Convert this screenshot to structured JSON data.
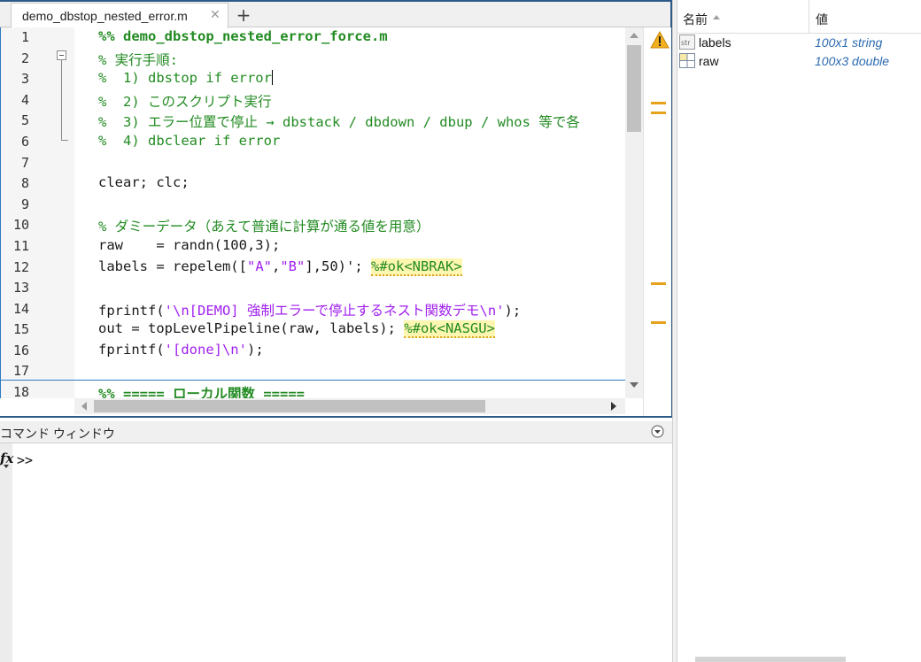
{
  "editor": {
    "tab_label": "demo_dbstop_nested_error.m",
    "tab_close_glyph": "✕",
    "tab_add_glyph": "+",
    "line_numbers": [
      "1",
      "2",
      "3",
      "4",
      "5",
      "6",
      "7",
      "8",
      "9",
      "10",
      "11",
      "12",
      "13",
      "14",
      "15",
      "16",
      "17",
      "18"
    ],
    "lines": {
      "l1": "%% demo_dbstop_nested_error_force.m",
      "l2": "% 実行手順:",
      "l3": "%  1) dbstop if error",
      "l4": "%  2) このスクリプト実行",
      "l5": "%  3) エラー位置で停止 → dbstack / dbdown / dbup / whos 等で各",
      "l6": "%  4) dbclear if error",
      "l8": "clear; clc;",
      "l10": "% ダミーデータ（あえて普通に計算が通る値を用意）",
      "l11_a": "raw    = randn(100,3);",
      "l12_a": "labels = repelem([",
      "l12_s1": "\"A\"",
      "l12_b": ",",
      "l12_s2": "\"B\"",
      "l12_c": "],50)'; ",
      "l12_mark": "%#ok<NBRAK>",
      "l14_a": "fprintf(",
      "l14_s": "'\\n[DEMO] 強制エラーで停止するネスト関数デモ\\n'",
      "l14_b": ");",
      "l15_a": "out = topLevelPipeline(raw, labels); ",
      "l15_mark": "%#ok<NASGU>",
      "l16_a": "fprintf(",
      "l16_s": "'[done]\\n'",
      "l16_b": ");",
      "l18": "%% ===== ローカル関数 ====="
    }
  },
  "command_window": {
    "title": "コマンド ウィンドウ",
    "fx_label": "fx",
    "prompt": ">>"
  },
  "workspace": {
    "col_name": "名前",
    "col_value": "値",
    "rows": [
      {
        "name": "labels",
        "value": "100x1 string",
        "icon": "string-variable-icon"
      },
      {
        "name": "raw",
        "value": "100x3 double",
        "icon": "matrix-variable-icon"
      }
    ]
  },
  "colors": {
    "comment": "#228b22",
    "string": "#a020f0",
    "accent_border": "#2e5a8a",
    "warning": "#e5a21a",
    "workspace_value": "#2a6ab0"
  }
}
